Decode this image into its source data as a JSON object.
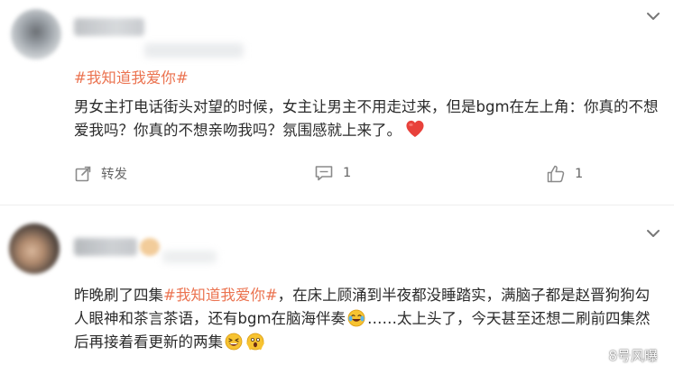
{
  "posts": [
    {
      "topic": "#我知道我爱你#",
      "text": "男女主打电话街头对望的时候，女主让男主不用走过来，但是bgm在左上角：你真的不想爱我吗？你真的不想亲吻我吗？氛围感就上来了。",
      "actions": {
        "share_label": "转发",
        "comment_count": "1",
        "like_count": "1"
      }
    },
    {
      "text_before": "昨晚刷了四集",
      "topic": "#我知道我爱你#",
      "text_middle": "，在床上顾涌到半夜都没睡踏实，满脑子都是赵晋狗狗勾人眼神和茶言茶语，还有bgm在脑海伴奏",
      "text_after_emoji": "……太上头了，今天甚至还想二刷前四集然后再接着看更新的两集"
    }
  ],
  "watermark": "8号风曝",
  "colors": {
    "topic": "#eb7350",
    "heart": "#e8413b",
    "icon": "#8a8a8a"
  },
  "icons": [
    "chevron-down-icon",
    "share-icon",
    "comment-icon",
    "like-icon",
    "heart-emoji",
    "laugh-cry-emoji",
    "grin-emoji",
    "scream-emoji",
    "wechat-icon"
  ]
}
